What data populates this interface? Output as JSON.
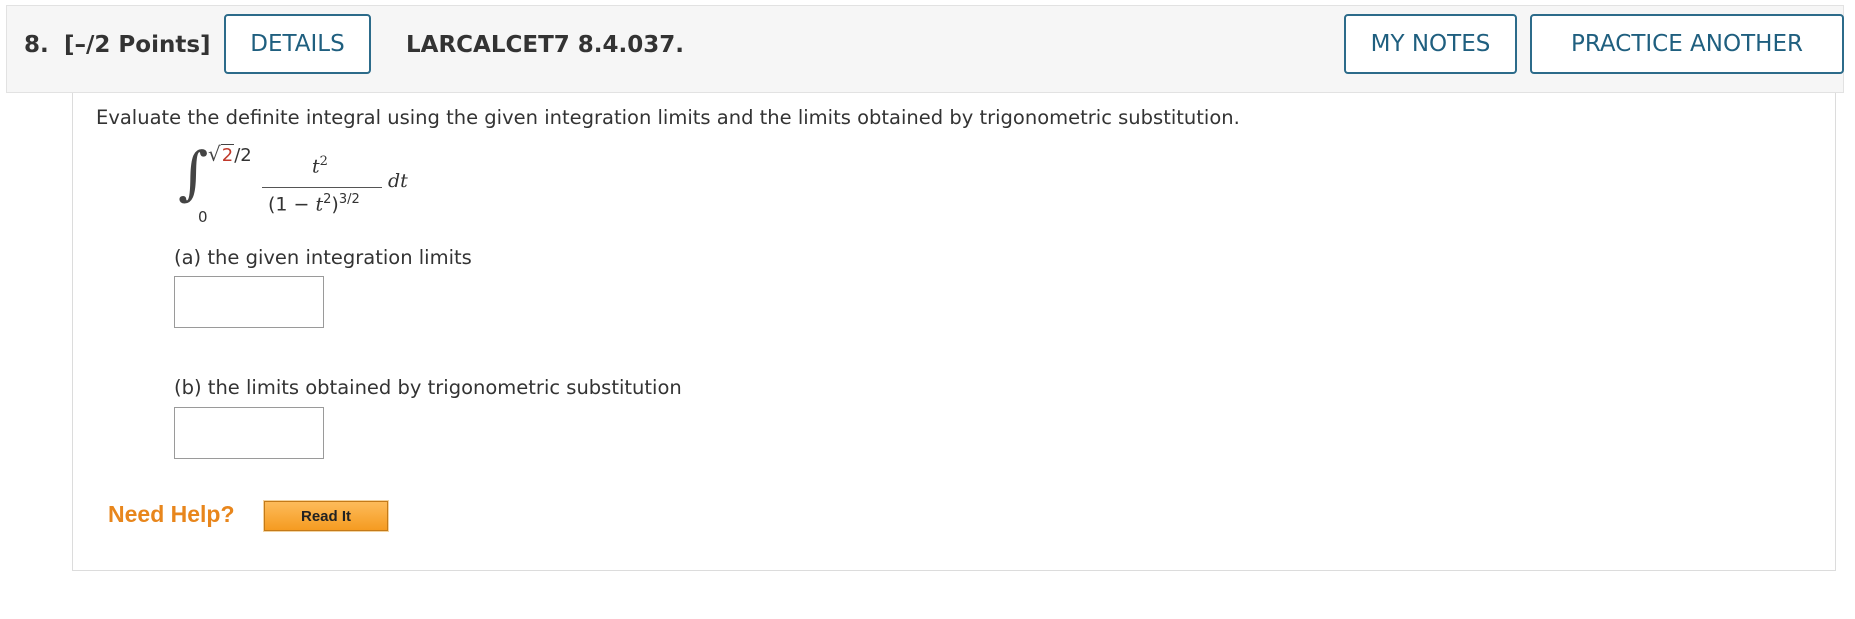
{
  "header": {
    "question_number": "8.",
    "points": "[–/2 Points]",
    "details_label": "DETAILS",
    "question_code": "LARCALCET7 8.4.037.",
    "my_notes_label": "MY NOTES",
    "practice_another_label": "PRACTICE ANOTHER"
  },
  "question": {
    "prompt": "Evaluate the definite integral using the given integration limits and the limits obtained by trigonometric substitution.",
    "integral": {
      "upper_limit_sqrt_arg": "2",
      "upper_limit_rest": "/2",
      "lower_limit": "0",
      "numerator_var": "t",
      "numerator_exp": "2",
      "denominator_prefix": "(1 − ",
      "denominator_var": "t",
      "denominator_inner_exp": "2",
      "denominator_close": ")",
      "denominator_outer_exp": "3/2",
      "differential": "dt"
    },
    "part_a_label": "(a) the given integration limits",
    "part_a_value": "",
    "part_b_label": "(b) the limits obtained by trigonometric substitution",
    "part_b_value": ""
  },
  "help": {
    "label": "Need Help?",
    "read_it_label": "Read It"
  },
  "colors": {
    "button_border": "#2c6b8a",
    "button_text": "#1f5f7f",
    "need_help": "#e8861c",
    "read_it_bg": "#f59b21",
    "sqrt_arg": "#c0392b"
  }
}
